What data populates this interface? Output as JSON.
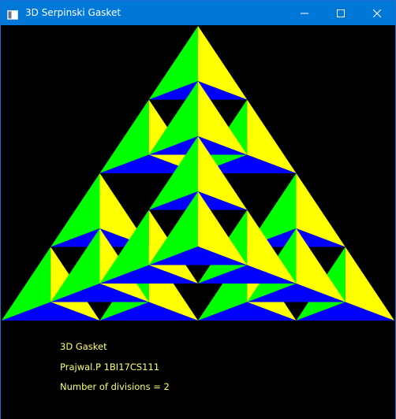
{
  "window": {
    "title": "3D Serpinski Gasket",
    "app_icon": "window-icon",
    "controls": [
      "minimize-icon",
      "maximize-icon",
      "close-icon"
    ]
  },
  "gasket": {
    "divisions": 2,
    "face_colors": [
      "#00ff00",
      "#ffff00",
      "#0000ff"
    ]
  },
  "info": {
    "line1": "3D Gasket",
    "line2": "Prajwal.P 1BI17CS111",
    "line3": "Number of divisions = 2"
  },
  "colors": {
    "titlebar": "#0078d7",
    "background": "#000000",
    "text": "#ffff66"
  }
}
